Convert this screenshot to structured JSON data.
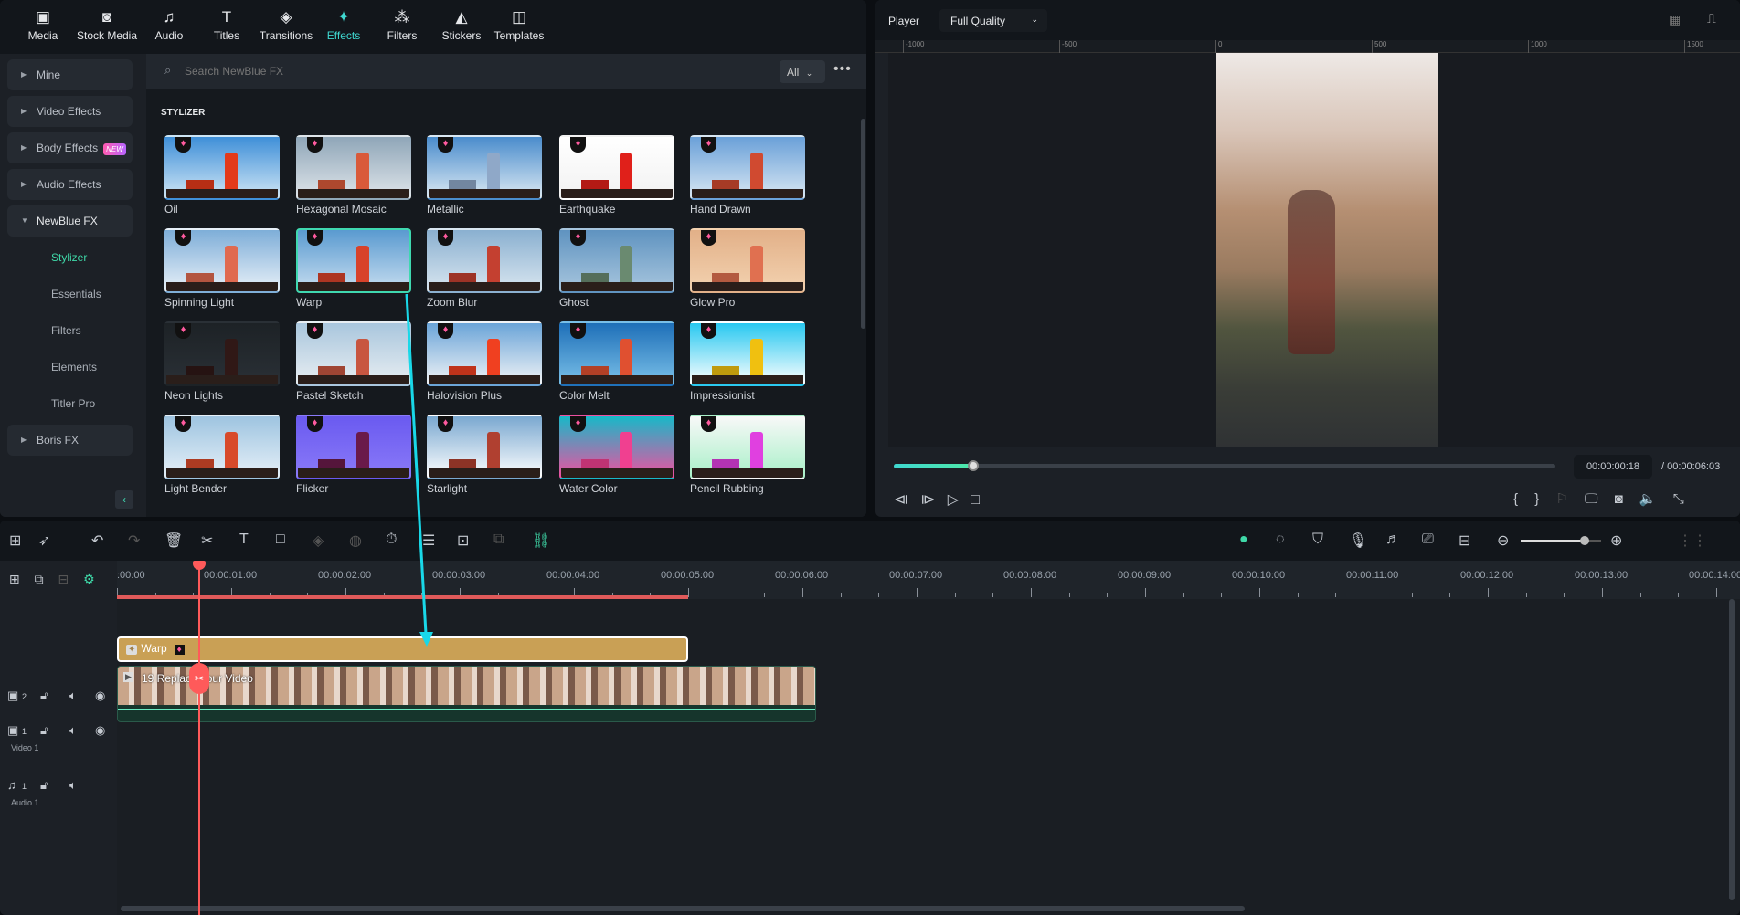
{
  "nav": {
    "tabs": [
      {
        "label": "Media",
        "icon": "media-icon",
        "glyph": "▣"
      },
      {
        "label": "Stock Media",
        "icon": "stock-media-icon",
        "glyph": "◙"
      },
      {
        "label": "Audio",
        "icon": "music-note-icon",
        "glyph": "♫"
      },
      {
        "label": "Titles",
        "icon": "titles-icon",
        "glyph": "T"
      },
      {
        "label": "Transitions",
        "icon": "transitions-icon",
        "glyph": "◈"
      },
      {
        "label": "Effects",
        "icon": "effects-icon",
        "glyph": "✦",
        "active": true
      },
      {
        "label": "Filters",
        "icon": "filters-icon",
        "glyph": "⁂"
      },
      {
        "label": "Stickers",
        "icon": "stickers-icon",
        "glyph": "◭"
      },
      {
        "label": "Templates",
        "icon": "templates-icon",
        "glyph": "◫"
      }
    ]
  },
  "sidebar": {
    "items": [
      {
        "label": "Mine",
        "expanded": false
      },
      {
        "label": "Video Effects",
        "expanded": false
      },
      {
        "label": "Body Effects",
        "expanded": false,
        "badge": "NEW"
      },
      {
        "label": "Audio Effects",
        "expanded": false
      },
      {
        "label": "NewBlue FX",
        "expanded": true
      }
    ],
    "subitems": [
      {
        "label": "Stylizer",
        "active": true
      },
      {
        "label": "Essentials"
      },
      {
        "label": "Filters"
      },
      {
        "label": "Elements"
      },
      {
        "label": "Titler Pro"
      }
    ],
    "after": [
      {
        "label": "Boris FX",
        "expanded": false
      }
    ]
  },
  "search": {
    "placeholder": "Search NewBlue FX",
    "filter": "All"
  },
  "section_title": "STYLIZER",
  "effects": [
    {
      "label": "Oil",
      "sky": [
        "#3f8fd8",
        "#cfe6f5"
      ],
      "tower": "#e33a1a"
    },
    {
      "label": "Hexagonal Mosaic",
      "sky": [
        "#8fa6b8",
        "#dfe5ea"
      ],
      "tower": "#d95a3a"
    },
    {
      "label": "Metallic",
      "sky": [
        "#4a8ccc",
        "#dbe9f3"
      ],
      "tower": "#8fa8c8"
    },
    {
      "label": "Earthquake",
      "sky": [
        "#ffffff",
        "#f2f2f2"
      ],
      "tower": "#e0201a"
    },
    {
      "label": "Hand Drawn",
      "sky": [
        "#6aa0d8",
        "#d8e7f3"
      ],
      "tower": "#d04a30"
    },
    {
      "label": "Spinning Light",
      "sky": [
        "#7eaed8",
        "#e8f0f8"
      ],
      "tower": "#e06a50"
    },
    {
      "label": "Warp",
      "sky": [
        "#5a9ad0",
        "#c7def0"
      ],
      "tower": "#d8422a",
      "selected": true
    },
    {
      "label": "Zoom Blur",
      "sky": [
        "#8ab0d0",
        "#d9e6f0"
      ],
      "tower": "#c44030"
    },
    {
      "label": "Ghost",
      "sky": [
        "#5f93c0",
        "#a8c6de"
      ],
      "tower": "#6a8a70"
    },
    {
      "label": "Glow Pro",
      "sky": [
        "#e2b088",
        "#f3d2b0"
      ],
      "tower": "#e07050"
    },
    {
      "label": "Neon Lights",
      "sky": [
        "#1d2226",
        "#2a3036"
      ],
      "tower": "#301816"
    },
    {
      "label": "Pastel Sketch",
      "sky": [
        "#a9c6dd",
        "#e8eef2"
      ],
      "tower": "#c85640"
    },
    {
      "label": "Halovision Plus",
      "sky": [
        "#6aa4d8",
        "#f2f4f6"
      ],
      "tower": "#f04020"
    },
    {
      "label": "Color Melt",
      "sky": [
        "#1e6fb8",
        "#7ac0e8"
      ],
      "tower": "#e05030"
    },
    {
      "label": "Impressionist",
      "sky": [
        "#28c8f0",
        "#ffffff"
      ],
      "tower": "#f0c010"
    },
    {
      "label": "Light Bender",
      "sky": [
        "#9ec4e0",
        "#e6f0f8"
      ],
      "tower": "#d84a2a"
    },
    {
      "label": "Flicker",
      "sky": [
        "#6a5af0",
        "#8a7af8"
      ],
      "tower": "#6a1a4a"
    },
    {
      "label": "Starlight",
      "sky": [
        "#7aa8d0",
        "#ffffff"
      ],
      "tower": "#b04030"
    },
    {
      "label": "Water Color",
      "sky": [
        "#18b8c8",
        "#f050a0"
      ],
      "tower": "#f04090"
    },
    {
      "label": "Pencil Rubbing",
      "sky": [
        "#f8f8f8",
        "#a8f0c8"
      ],
      "tower": "#e040e0"
    }
  ],
  "player": {
    "label": "Player",
    "quality": "Full Quality",
    "ruler_labels": [
      "-1000",
      "-500",
      "0",
      "500",
      "1000",
      "1500"
    ],
    "current_time": "00:00:00:18",
    "total_time": "/ 00:00:06:03",
    "progress": 0.12
  },
  "timeline": {
    "ruler_labels": [
      ":00:00",
      "00:00:01:00",
      "00:00:02:00",
      "00:00:03:00",
      "00:00:04:00",
      "00:00:05:00",
      "00:00:06:00",
      "00:00:07:00",
      "00:00:08:00",
      "00:00:09:00",
      "00:00:10:00",
      "00:00:11:00",
      "00:00:12:00",
      "00:00:13:00",
      "00:00:14:00"
    ],
    "playhead_seconds": 0.72,
    "zoom_level": 0.8,
    "tracks": [
      {
        "num": "2",
        "name": ""
      },
      {
        "num": "1",
        "name": "Video 1"
      },
      {
        "num": "1",
        "name": "Audio 1"
      }
    ],
    "effect_clip": {
      "label": "Warp",
      "start": 0,
      "end": 5
    },
    "video_clip": {
      "label": "19 Replace Your Video",
      "start": 0,
      "end": 6.12
    }
  },
  "colors": {
    "accent": "#3fd8d0",
    "playhead": "#ff5a5a",
    "effect_clip": "#c9a055",
    "arrow": "#19d8e8"
  }
}
